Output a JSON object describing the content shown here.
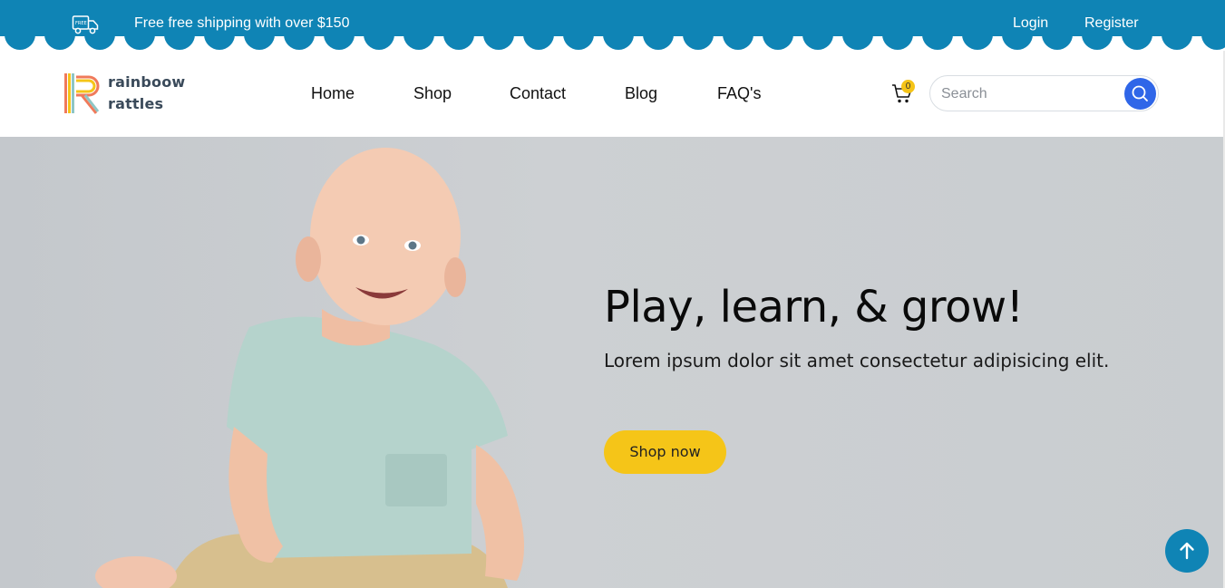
{
  "topbar": {
    "shipping_text": "Free free shipping with over $150",
    "truck_icon": "truck-icon",
    "login_label": "Login",
    "register_label": "Register",
    "color": "#0f84b5"
  },
  "header": {
    "logo_line1": "rainboow",
    "logo_line2": "rattles",
    "nav": [
      "Home",
      "Shop",
      "Contact",
      "Blog",
      "FAQ's"
    ],
    "cart_count": "0",
    "cart_icon": "cart-icon",
    "search_placeholder": "Search",
    "search_icon": "search-icon",
    "search_button_color": "#2f66e8"
  },
  "hero": {
    "title": "Play, learn, & grow!",
    "subtitle": "Lorem ipsum dolor sit amet consectetur adipisicing elit.",
    "button_label": "Shop now",
    "button_color": "#f5c518"
  },
  "scroll_top": {
    "icon": "arrow-up-icon",
    "color": "#0f84b5"
  }
}
